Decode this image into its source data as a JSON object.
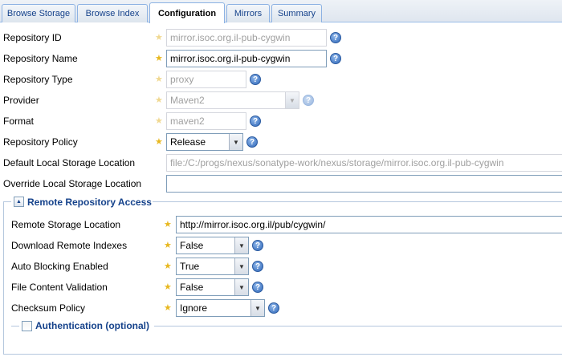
{
  "tabs": [
    {
      "label": "Browse Storage"
    },
    {
      "label": "Browse Index"
    },
    {
      "label": "Configuration"
    },
    {
      "label": "Mirrors"
    },
    {
      "label": "Summary"
    }
  ],
  "form": {
    "repository_id": {
      "label": "Repository ID",
      "value": "mirror.isoc.org.il-pub-cygwin"
    },
    "repository_name": {
      "label": "Repository Name",
      "value": "mirror.isoc.org.il-pub-cygwin"
    },
    "repository_type": {
      "label": "Repository Type",
      "value": "proxy"
    },
    "provider": {
      "label": "Provider",
      "value": "Maven2"
    },
    "format": {
      "label": "Format",
      "value": "maven2"
    },
    "repository_policy": {
      "label": "Repository Policy",
      "value": "Release"
    },
    "default_storage": {
      "label": "Default Local Storage Location",
      "value": "file:/C:/progs/nexus/sonatype-work/nexus/storage/mirror.isoc.org.il-pub-cygwin"
    },
    "override_storage": {
      "label": "Override Local Storage Location",
      "value": ""
    }
  },
  "remote": {
    "title": "Remote Repository Access",
    "storage_location": {
      "label": "Remote Storage Location",
      "value": "http://mirror.isoc.org.il/pub/cygwin/"
    },
    "download_indexes": {
      "label": "Download Remote Indexes",
      "value": "False"
    },
    "auto_blocking": {
      "label": "Auto Blocking Enabled",
      "value": "True"
    },
    "file_validation": {
      "label": "File Content Validation",
      "value": "False"
    },
    "checksum_policy": {
      "label": "Checksum Policy",
      "value": "Ignore"
    }
  },
  "authentication": {
    "title": "Authentication (optional)",
    "checked": false
  },
  "icons": {
    "help": "help-icon",
    "required": "required-star-icon",
    "dropdown": "dropdown-arrow-icon"
  },
  "colors": {
    "accent": "#15428b",
    "required_star": "#e8b820",
    "help": "#2f67b9"
  }
}
